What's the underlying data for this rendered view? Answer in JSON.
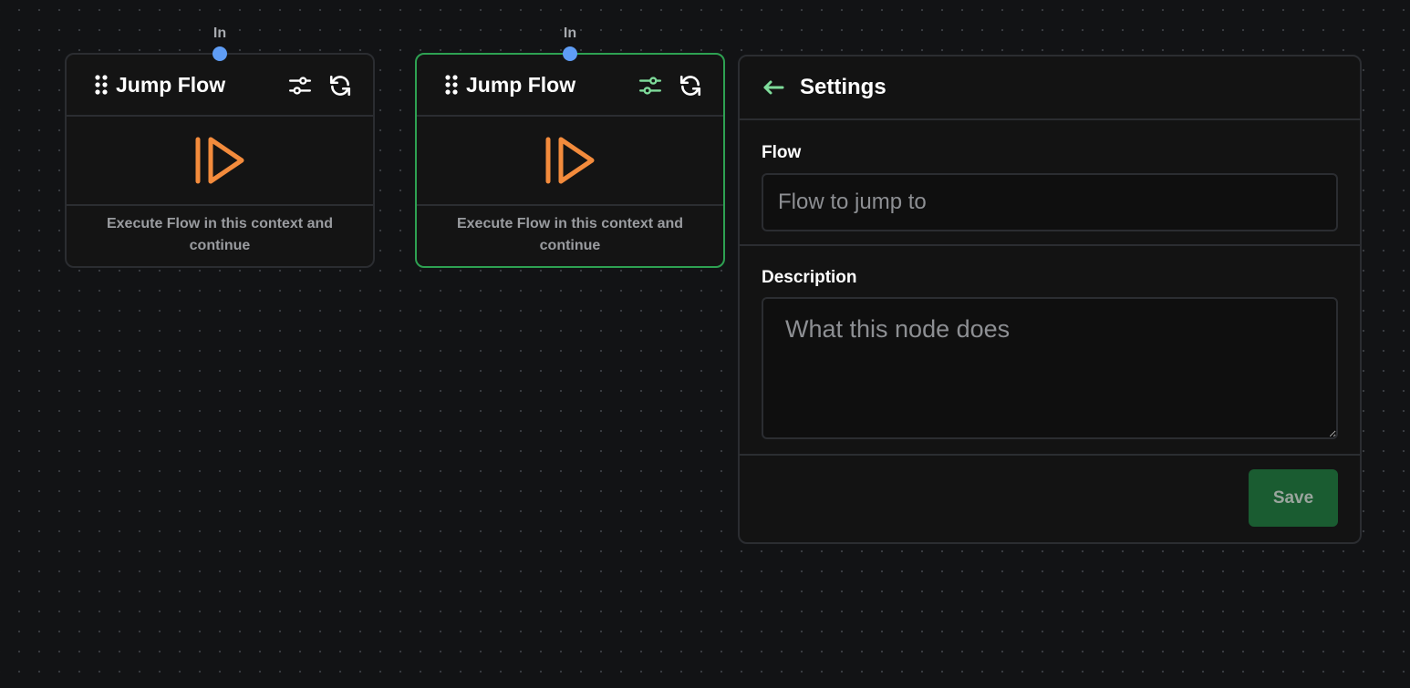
{
  "nodes": [
    {
      "port_label": "In",
      "title": "Jump Flow",
      "description": "Execute Flow in this context and continue",
      "selected": false
    },
    {
      "port_label": "In",
      "title": "Jump Flow",
      "description": "Execute Flow in this context and continue",
      "selected": true
    }
  ],
  "settings": {
    "title": "Settings",
    "flow_label": "Flow",
    "flow_value": "",
    "flow_placeholder": "Flow to jump to",
    "description_label": "Description",
    "description_value": "",
    "description_placeholder": "What this node does",
    "save_label": "Save"
  },
  "icons": {
    "drag_handle": "drag-dots-icon",
    "node_settings": "sliders-icon",
    "node_refresh": "refresh-icon",
    "node_type": "skip-forward-icon",
    "back": "arrow-left-icon"
  },
  "colors": {
    "canvas_bg": "#121315",
    "port": "#5f9df5",
    "selected_border": "#2ea152",
    "active_icon": "#7fdc9b",
    "node_icon": "#f38b3c",
    "save_button": "#1a5c31"
  }
}
